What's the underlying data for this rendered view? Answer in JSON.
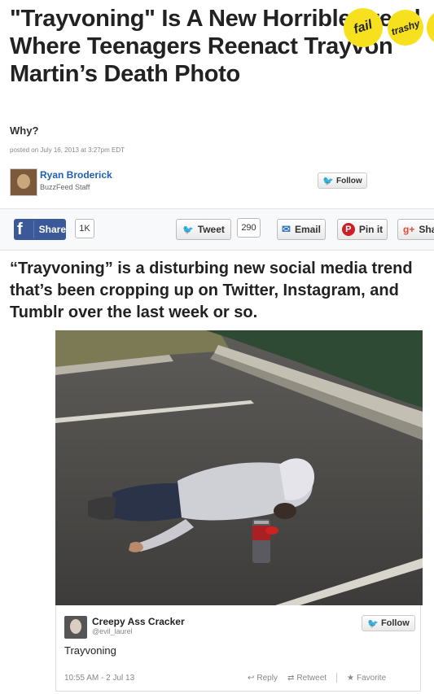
{
  "article": {
    "title": "\"Trayvoning\" Is A New Horrible Trend Where Teenagers Reenact Trayvon Martin’s Death Photo",
    "subtitle": "Why?",
    "posted": "posted on July 16, 2013 at 3:27pm EDT",
    "lede": [
      "“Trayvoning” is a disturbing new social media trend",
      "that’s been cropping up on Twitter, Instagram, and",
      "Tumblr over the last week or so."
    ]
  },
  "badges": [
    "fail",
    "trashy",
    "⚡"
  ],
  "author": {
    "name": "Ryan Broderick",
    "role": "BuzzFeed Staff",
    "follow_label": "Follow"
  },
  "share": {
    "facebook_label": "Share",
    "facebook_count": "1K",
    "tweet_label": "Tweet",
    "tweet_count": "290",
    "email_label": "Email",
    "pin_label": "Pin it",
    "gplus_label": "Sha"
  },
  "tweet": {
    "name": "Creepy Ass Cracker",
    "handle": "@evil_laurel",
    "follow_label": "Follow",
    "text": "Trayvoning",
    "time": "10:55 AM - 2 Jul 13",
    "reply": "Reply",
    "retweet": "Retweet",
    "favorite": "Favorite"
  },
  "colors": {
    "link_blue": "#1f5fb5",
    "facebook": "#3b5998",
    "badge_yellow": "#f7e11f",
    "pinterest": "#cb2027",
    "twitter": "#1da1f2"
  }
}
